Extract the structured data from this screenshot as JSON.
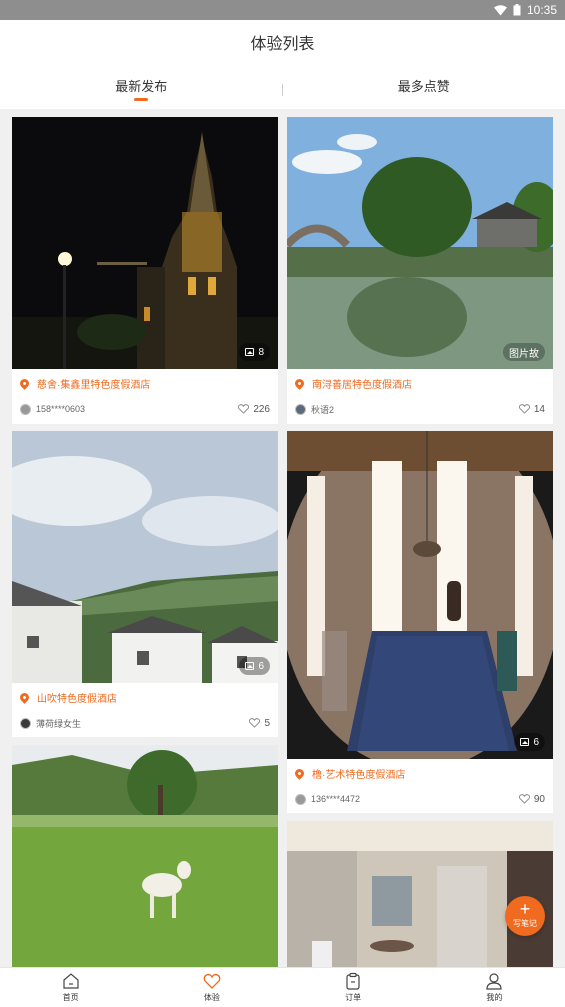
{
  "status_bar": {
    "time": "10:35"
  },
  "header": {
    "title": "体验列表"
  },
  "tabs": [
    {
      "label": "最新发布",
      "active": true
    },
    {
      "label": "最多点赞",
      "active": false
    }
  ],
  "posts": [
    {
      "hotel": "慈舍·集鑫里特色度假酒店",
      "user": "158****0603",
      "likes": "226",
      "photo_count": "8",
      "photo": "church-at-night"
    },
    {
      "hotel": "南浔善居特色度假酒店",
      "user": "秋语2",
      "likes": "14",
      "photo_count": "",
      "photo": "water-town-bridge",
      "watermark": "图片故"
    },
    {
      "hotel": "山吹特色度假酒店",
      "user": "薄荷绿女生",
      "likes": "5",
      "photo_count": "6",
      "photo": "mountain-houses"
    },
    {
      "hotel": "橹·艺术特色度假酒店",
      "user": "136****4472",
      "likes": "90",
      "photo_count": "6",
      "photo": "dining-room-fisheye"
    },
    {
      "hotel": "",
      "user": "",
      "likes": "",
      "photo_count": "",
      "photo": "lawn-with-dog"
    },
    {
      "hotel": "",
      "user": "",
      "likes": "",
      "photo_count": "",
      "photo": "bathroom"
    }
  ],
  "fab": {
    "label": "写笔记",
    "icon": "plus-icon"
  },
  "bottom_nav": [
    {
      "label": "首页",
      "icon": "home-icon",
      "active": false
    },
    {
      "label": "体验",
      "icon": "heart-icon",
      "active": true
    },
    {
      "label": "订单",
      "icon": "clipboard-icon",
      "active": false
    },
    {
      "label": "我的",
      "icon": "user-icon",
      "active": false
    }
  ],
  "colors": {
    "accent": "#f06a1f",
    "status_bar": "#8e8e8e",
    "background": "#f0f0f0"
  }
}
